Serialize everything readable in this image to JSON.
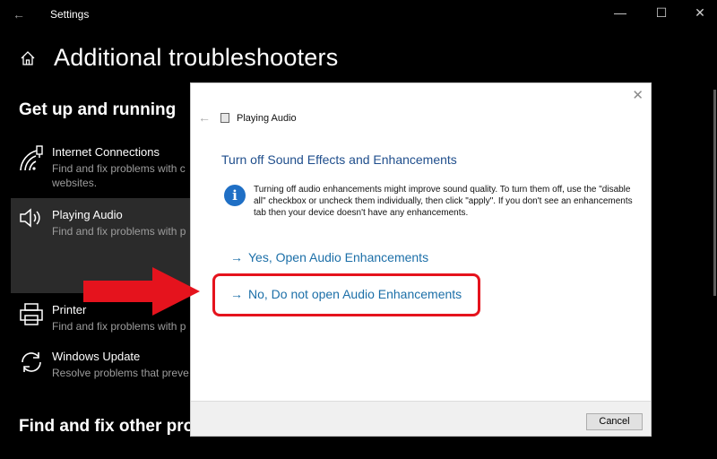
{
  "window": {
    "app_title": "Settings",
    "back_icon": "back-arrow-icon",
    "minimize_glyph": "—",
    "maximize_glyph": "☐",
    "close_glyph": "✕"
  },
  "page": {
    "title": "Additional troubleshooters",
    "home_icon": "home-icon"
  },
  "sections": [
    {
      "title": "Get up and running",
      "items": [
        {
          "name": "Internet Connections",
          "description": "Find and fix problems with c websites.",
          "icon": "wifi-icon"
        },
        {
          "name": "Playing Audio",
          "description": "Find and fix problems with p",
          "icon": "speaker-icon",
          "selected": true
        },
        {
          "name": "Printer",
          "description": "Find and fix problems with p",
          "icon": "printer-icon"
        },
        {
          "name": "Windows Update",
          "description": "Resolve problems that preve",
          "icon": "refresh-icon"
        }
      ]
    },
    {
      "title": "Find and fix other proble",
      "items": []
    }
  ],
  "dialog": {
    "title": "Playing Audio",
    "close_glyph": "✕",
    "back_glyph": "←",
    "heading": "Turn off Sound Effects and Enhancements",
    "info_icon": "info-icon",
    "info_glyph": "i",
    "info_text": "Turning off audio enhancements might improve sound quality. To turn them off, use the \"disable all\" checkbox or uncheck them individually, then click \"apply\". If you don't see an enhancements tab then your device doesn't have any enhancements.",
    "options": [
      {
        "label": "Yes, Open Audio Enhancements",
        "arrow": "→"
      },
      {
        "label": "No, Do not open Audio Enhancements",
        "arrow": "→",
        "highlighted": true
      }
    ],
    "cancel_label": "Cancel"
  },
  "annotation": {
    "color": "#e5131d",
    "points_to": "No, Do not open Audio Enhancements"
  }
}
